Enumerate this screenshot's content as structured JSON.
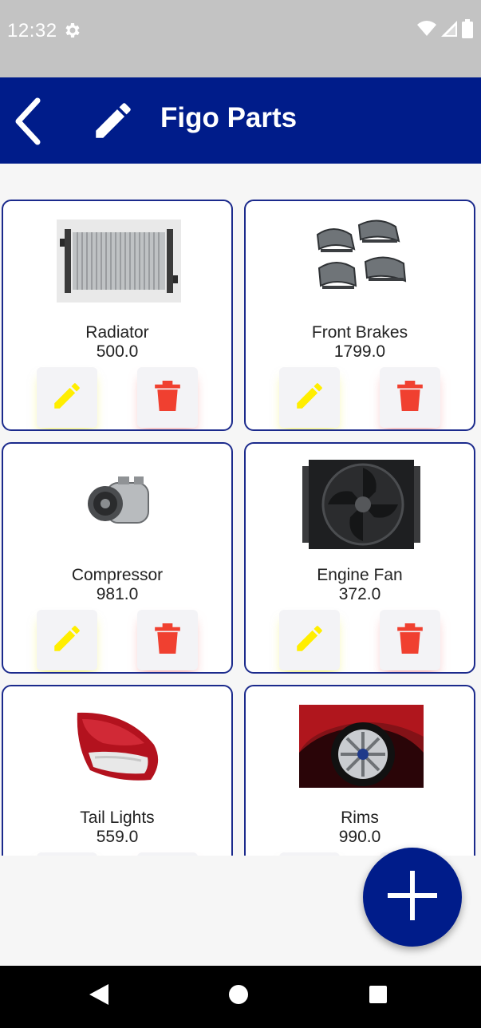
{
  "status_bar": {
    "time": "12:32",
    "icons": [
      "gear-icon",
      "wifi-icon",
      "signal-icon",
      "battery-icon"
    ]
  },
  "app_bar": {
    "title": "Figo Parts",
    "background": "#001c8a",
    "back_icon": "chevron-left-icon",
    "edit_icon": "pencil-icon"
  },
  "parts": [
    {
      "name": "Radiator",
      "price": "500.0",
      "image": "radiator-image"
    },
    {
      "name": "Front Brakes",
      "price": "1799.0",
      "image": "brake-pads-image"
    },
    {
      "name": "Compressor",
      "price": "981.0",
      "image": "compressor-image"
    },
    {
      "name": "Engine Fan",
      "price": "372.0",
      "image": "engine-fan-image"
    },
    {
      "name": "Tail Lights",
      "price": "559.0",
      "image": "tail-light-image"
    },
    {
      "name": "Rims",
      "price": "990.0",
      "image": "rim-image"
    }
  ],
  "card_actions": {
    "edit_icon": "pencil-icon",
    "delete_icon": "trash-icon",
    "edit_color": "#ffee00",
    "delete_color": "#f04030"
  },
  "fab": {
    "icon": "plus-icon",
    "color": "#001c8a"
  },
  "nav_bar": {
    "icons": [
      "nav-back-icon",
      "nav-home-icon",
      "nav-recent-icon"
    ]
  }
}
